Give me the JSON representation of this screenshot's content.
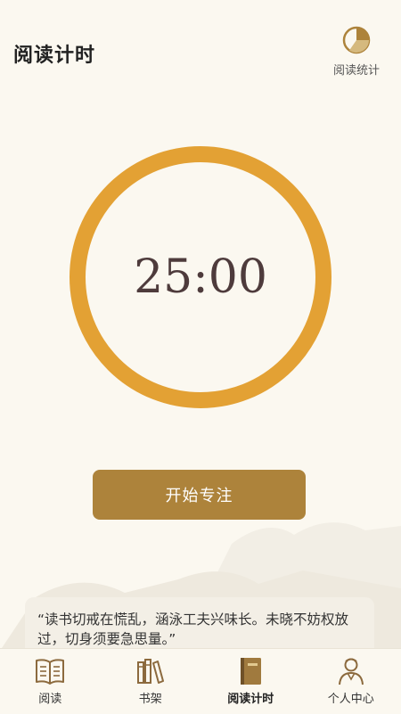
{
  "header": {
    "title": "阅读计时",
    "stats_icon": "pie-chart-icon",
    "stats_label": "阅读统计"
  },
  "timer": {
    "display": "25:00",
    "progress": 1.0
  },
  "actions": {
    "start_label": "开始专注"
  },
  "quote": {
    "text": "“读书切戒在慌乱，涵泳工夫兴味长。未晓不妨权放过，切身须要急思量。”"
  },
  "tabbar": {
    "active_index": 2,
    "items": [
      {
        "label": "阅读",
        "icon": "open-book-icon"
      },
      {
        "label": "书架",
        "icon": "bookshelf-icon"
      },
      {
        "label": "阅读计时",
        "icon": "closed-book-icon"
      },
      {
        "label": "个人中心",
        "icon": "person-icon"
      }
    ]
  },
  "colors": {
    "background": "#FBF8F0",
    "ring": "#E3A134",
    "accent": "#AD833B",
    "timer_text": "#4E3B3C"
  }
}
